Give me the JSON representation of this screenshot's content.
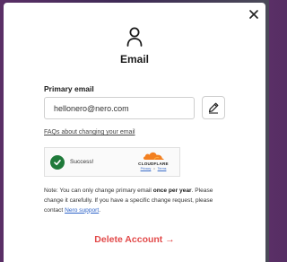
{
  "dialog": {
    "title": "Email"
  },
  "primary_email": {
    "label": "Primary email",
    "value": "hellonero@nero.com"
  },
  "faq": {
    "link_text": "FAQs about changing your email"
  },
  "captcha": {
    "status": "Success!",
    "brand": "CLOUDFLARE",
    "privacy_link": "Privacy",
    "separator": "•",
    "terms_link": "Terms",
    "check_color": "#1f7a3a",
    "brand_color": "#f38020"
  },
  "note": {
    "prefix": "Note: You can only change primary email ",
    "emphasis": "once per year",
    "middle": ". Please change it carefully. If you have a specific change request, please contact ",
    "link_text": "Nero support",
    "suffix": "."
  },
  "delete": {
    "label": "Delete Account →",
    "color": "#e24a4a"
  },
  "icons": {
    "close": "close-icon",
    "user": "user-icon",
    "edit": "pencil-icon",
    "check": "check-icon",
    "cloud": "cloudflare-cloud-icon"
  }
}
